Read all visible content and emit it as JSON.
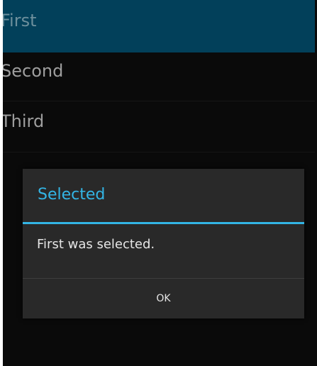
{
  "list": {
    "items": [
      {
        "label": "First"
      },
      {
        "label": "Second"
      },
      {
        "label": "Third"
      }
    ],
    "selected_item": "First"
  },
  "dialog": {
    "title": "Selected",
    "message": "First was selected.",
    "ok_label": "OK"
  },
  "colors": {
    "background": "#0a0a0a",
    "selected_row": "#02405a",
    "list_text": "#9e9e9e",
    "dialog_background": "#292929",
    "dialog_accent": "#33b5e5",
    "dialog_text": "#e6e6e6"
  }
}
